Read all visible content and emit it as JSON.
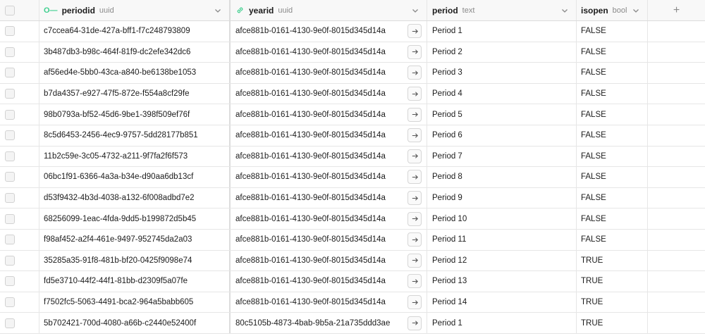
{
  "columns": [
    {
      "name": "periodid",
      "type": "uuid"
    },
    {
      "name": "yearid",
      "type": "uuid"
    },
    {
      "name": "period",
      "type": "text"
    },
    {
      "name": "isopen",
      "type": "bool"
    }
  ],
  "icons": {
    "periodid": "key-icon",
    "yearid": "link-icon",
    "add": "plus-icon",
    "row_link": "arrow-right-icon"
  },
  "rows": [
    {
      "periodid": "c7ccea64-31de-427a-bff1-f7c248793809",
      "yearid": "afce881b-0161-4130-9e0f-8015d345d14a",
      "period": "Period 1",
      "isopen": "FALSE"
    },
    {
      "periodid": "3b487db3-b98c-464f-81f9-dc2efe342dc6",
      "yearid": "afce881b-0161-4130-9e0f-8015d345d14a",
      "period": "Period 2",
      "isopen": "FALSE"
    },
    {
      "periodid": "af56ed4e-5bb0-43ca-a840-be6138be1053",
      "yearid": "afce881b-0161-4130-9e0f-8015d345d14a",
      "period": "Period 3",
      "isopen": "FALSE"
    },
    {
      "periodid": "b7da4357-e927-47f5-872e-f554a8cf29fe",
      "yearid": "afce881b-0161-4130-9e0f-8015d345d14a",
      "period": "Period 4",
      "isopen": "FALSE"
    },
    {
      "periodid": "98b0793a-bf52-45d6-9be1-398f509ef76f",
      "yearid": "afce881b-0161-4130-9e0f-8015d345d14a",
      "period": "Period 5",
      "isopen": "FALSE"
    },
    {
      "periodid": "8c5d6453-2456-4ec9-9757-5dd28177b851",
      "yearid": "afce881b-0161-4130-9e0f-8015d345d14a",
      "period": "Period 6",
      "isopen": "FALSE"
    },
    {
      "periodid": "11b2c59e-3c05-4732-a211-9f7fa2f6f573",
      "yearid": "afce881b-0161-4130-9e0f-8015d345d14a",
      "period": "Period 7",
      "isopen": "FALSE"
    },
    {
      "periodid": "06bc1f91-6366-4a3a-b34e-d90aa6db13cf",
      "yearid": "afce881b-0161-4130-9e0f-8015d345d14a",
      "period": "Period 8",
      "isopen": "FALSE"
    },
    {
      "periodid": "d53f9432-4b3d-4038-a132-6f008adbd7e2",
      "yearid": "afce881b-0161-4130-9e0f-8015d345d14a",
      "period": "Period 9",
      "isopen": "FALSE"
    },
    {
      "periodid": "68256099-1eac-4fda-9dd5-b199872d5b45",
      "yearid": "afce881b-0161-4130-9e0f-8015d345d14a",
      "period": "Period 10",
      "isopen": "FALSE"
    },
    {
      "periodid": "f98af452-a2f4-461e-9497-952745da2a03",
      "yearid": "afce881b-0161-4130-9e0f-8015d345d14a",
      "period": "Period 11",
      "isopen": "FALSE"
    },
    {
      "periodid": "35285a35-91f8-481b-bf20-0425f9098e74",
      "yearid": "afce881b-0161-4130-9e0f-8015d345d14a",
      "period": "Period 12",
      "isopen": "TRUE"
    },
    {
      "periodid": "fd5e3710-44f2-44f1-81bb-d2309f5a07fe",
      "yearid": "afce881b-0161-4130-9e0f-8015d345d14a",
      "period": "Period 13",
      "isopen": "TRUE"
    },
    {
      "periodid": "f7502fc5-5063-4491-bca2-964a5babb605",
      "yearid": "afce881b-0161-4130-9e0f-8015d345d14a",
      "period": "Period 14",
      "isopen": "TRUE"
    },
    {
      "periodid": "5b702421-700d-4080-a66b-c2440e52400f",
      "yearid": "80c5105b-4873-4bab-9b5a-21a735ddd3ae",
      "period": "Period 1",
      "isopen": "TRUE"
    }
  ]
}
